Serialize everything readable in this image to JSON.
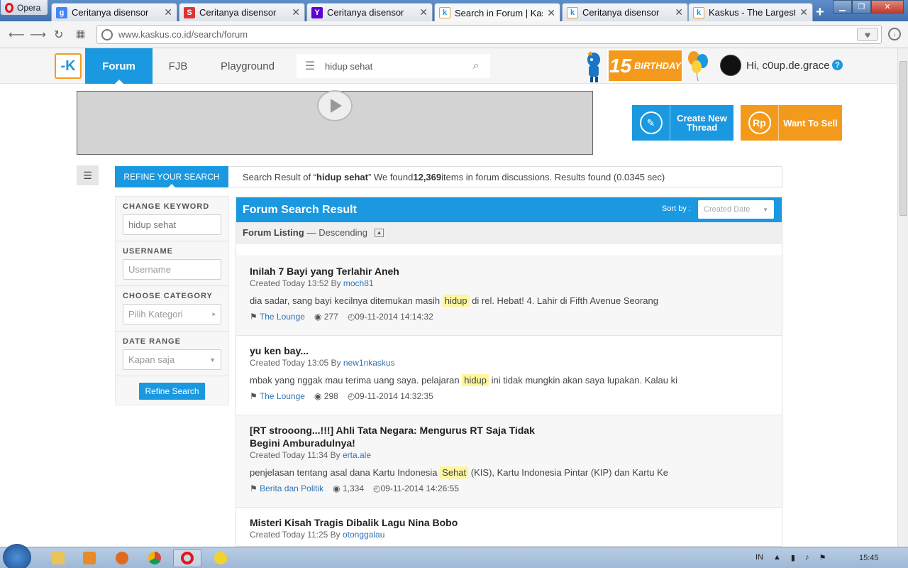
{
  "browser": {
    "menu_label": "Opera",
    "tabs": [
      {
        "title": "Ceritanya disensor",
        "favicon": "google-icon",
        "color": "#4285f4",
        "glyph": "g"
      },
      {
        "title": "Ceritanya disensor",
        "favicon": "s-icon",
        "color": "#d33",
        "glyph": "S"
      },
      {
        "title": "Ceritanya disensor",
        "favicon": "yahoo-icon",
        "color": "#5f01d1",
        "glyph": "Y"
      },
      {
        "title": "Search in Forum | Kasku",
        "favicon": "kaskus-icon",
        "color": "#1a98e0",
        "glyph": "k"
      },
      {
        "title": "Ceritanya disensor",
        "favicon": "kaskus-icon",
        "color": "#1a98e0",
        "glyph": "k"
      },
      {
        "title": "Kaskus - The Largest Ind",
        "favicon": "kaskus-icon",
        "color": "#1a98e0",
        "glyph": "k"
      }
    ],
    "new_tab": "+",
    "url": "www.kaskus.co.id/search/forum"
  },
  "header": {
    "nav": [
      "Forum",
      "FJB",
      "Playground"
    ],
    "search_query": "hidup sehat",
    "birthday_big": "15",
    "birthday_small": "BIRTHDAY",
    "greeting": "Hi, c0up.de.grace",
    "help": "?"
  },
  "cta": {
    "create_thread": "Create New Thread",
    "want_to_sell": "Want To Sell",
    "rp": "Rp"
  },
  "refine": {
    "tab_label": "REFINE YOUR SEARCH",
    "change_keyword": "CHANGE KEYWORD",
    "keyword_value": "hidup sehat",
    "username": "USERNAME",
    "username_placeholder": "Username",
    "choose_category": "CHOOSE CATEGORY",
    "category_placeholder": "Pilih Kategori",
    "date_range": "DATE RANGE",
    "date_value": "Kapan saja",
    "button": "Refine Search"
  },
  "summary": {
    "prefix": "Search Result of “",
    "query": "hidup sehat",
    "middle": "” We found ",
    "count": "12,369",
    "suffix": " items in forum discussions. Results found (0.0345 sec)"
  },
  "results": {
    "title": "Forum Search Result",
    "sort_label": "Sort by :",
    "sort_value": "Created Date",
    "listing_label": "Forum Listing",
    "listing_order": "— Descending",
    "items": [
      {
        "title": "Inilah 7 Bayi yang Terlahir Aneh",
        "created": "Created Today 13:52 By",
        "author": "moch81",
        "snip_before": "dia sadar, sang bayi kecilnya ditemukan masih",
        "snip_hl": "hidup",
        "snip_after": "di rel. Hebat! 4. Lahir di Fifth Avenue Seorang",
        "forum": "The Lounge",
        "views": "277",
        "date": "09-11-2014 14:14:32"
      },
      {
        "title": "yu ken bay...",
        "created": "Created Today 13:05 By",
        "author": "new1nkaskus",
        "snip_before": "mbak yang nggak mau terima uang saya. pelajaran",
        "snip_hl": "hidup",
        "snip_after": "ini tidak mungkin akan saya lupakan. Kalau ki",
        "forum": "The Lounge",
        "views": "298",
        "date": "09-11-2014 14:32:35"
      },
      {
        "title": "[RT strooong...!!!] Ahli Tata Negara: Mengurus RT Saja Tidak Begini Amburadulnya!",
        "created": "Created Today 11:34 By",
        "author": "erta.ale",
        "snip_before": "penjelasan tentang asal dana Kartu Indonesia",
        "snip_hl": "Sehat",
        "snip_after": "(KIS), Kartu Indonesia Pintar (KIP) dan Kartu Ke",
        "forum": "Berita dan Politik",
        "views": "1,334",
        "date": "09-11-2014 14:26:55"
      },
      {
        "title": "Misteri Kisah Tragis Dibalik Lagu Nina Bobo",
        "created": "Created Today 11:25 By",
        "author": "otonggalau",
        "snip_before": "",
        "snip_hl": "",
        "snip_after": "",
        "forum": "",
        "views": "",
        "date": ""
      }
    ]
  },
  "taskbar": {
    "lang": "IN",
    "time": "15:45"
  }
}
